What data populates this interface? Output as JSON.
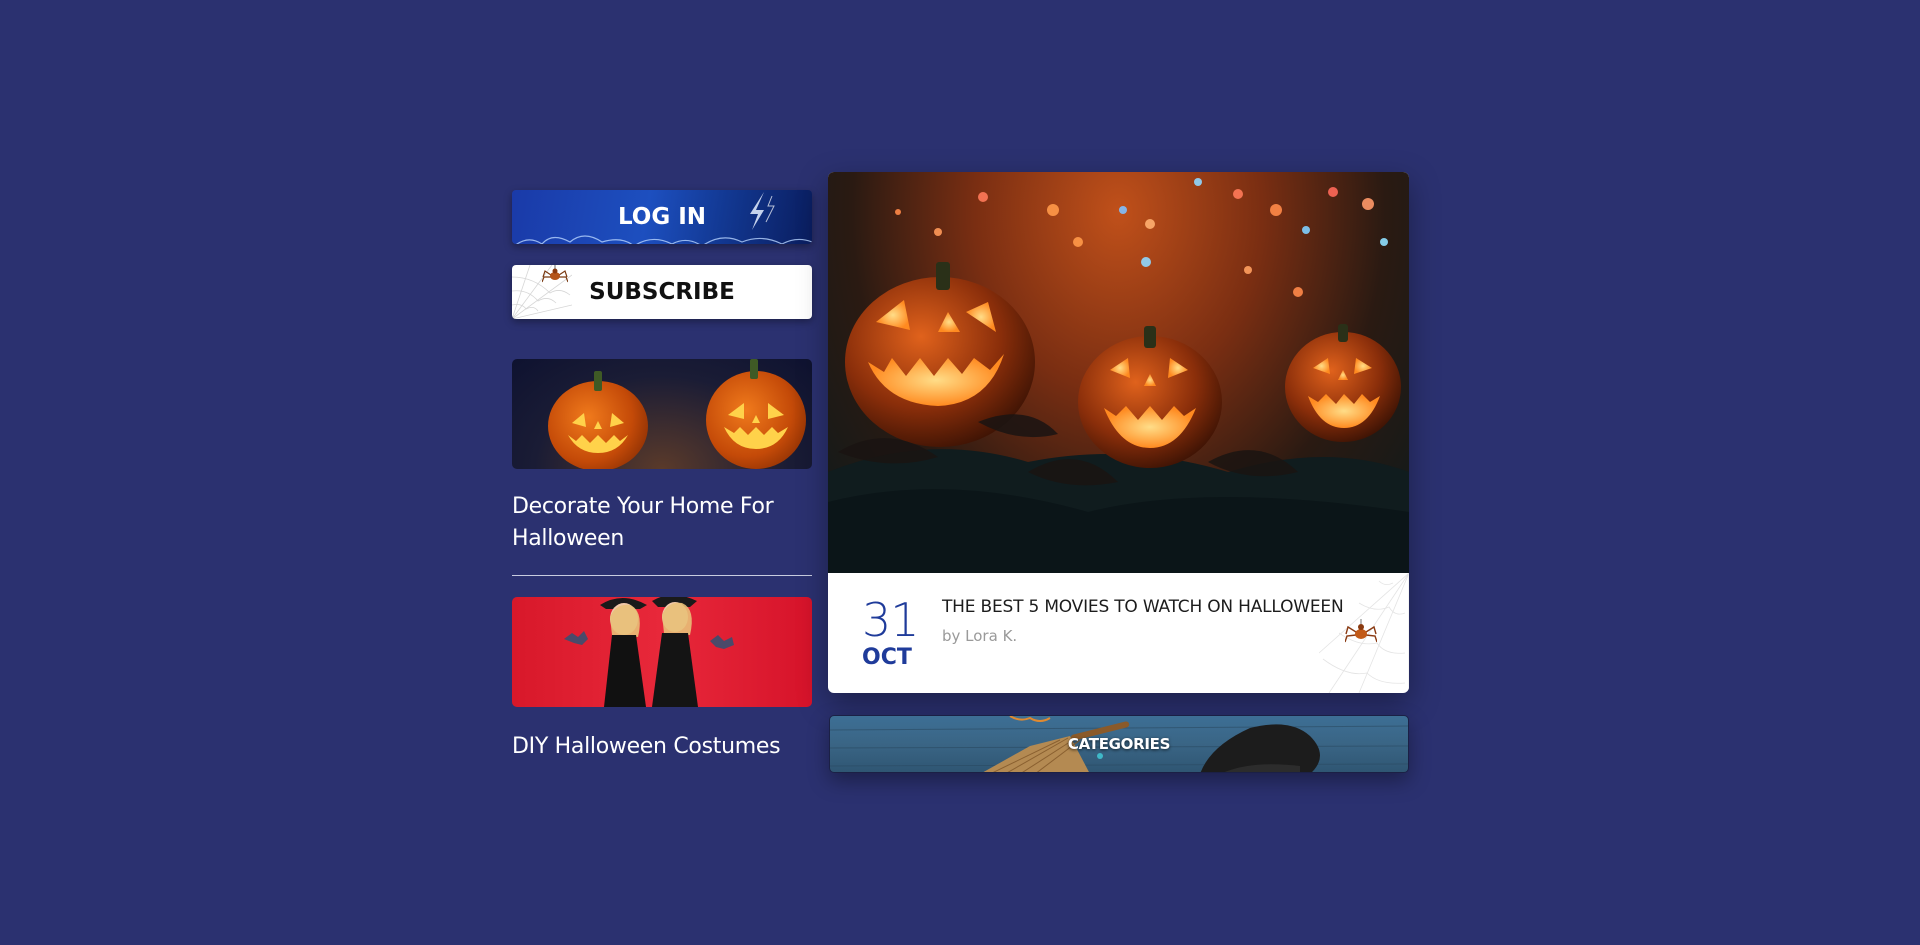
{
  "sidebar": {
    "login_label": "LOG IN",
    "subscribe_label": "SUBSCRIBE",
    "articles": [
      {
        "title": "Decorate Your Home For Halloween"
      },
      {
        "title": "DIY Halloween Costumes"
      }
    ]
  },
  "feature": {
    "day": "31",
    "month": "OCT",
    "title": "THE BEST 5 MOVIES TO WATCH ON HALLOWEEN",
    "author": "by Lora K."
  },
  "categories": {
    "label": "CATEGORIES"
  },
  "colors": {
    "background": "#2b3170",
    "accent": "#1f3b9a",
    "login_button": "#1d4fbf",
    "costume_bg": "#e8283a"
  },
  "icons": [
    "spider-icon",
    "spiderweb-icon",
    "lightning-icon"
  ]
}
